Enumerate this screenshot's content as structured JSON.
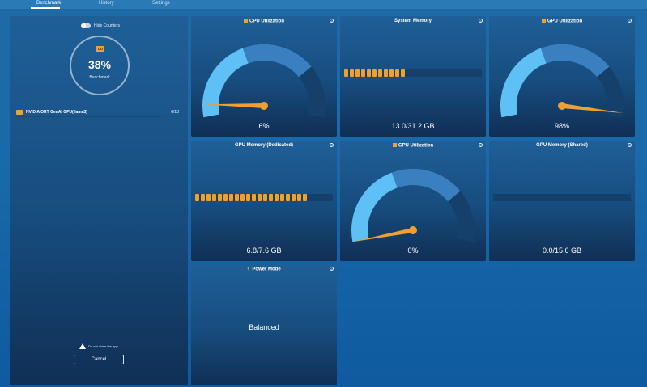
{
  "tabs": [
    {
      "label": "Benchmark",
      "active": true
    },
    {
      "label": "History",
      "active": false
    },
    {
      "label": "Settings",
      "active": false
    }
  ],
  "colors": {
    "accent": "#f0a030",
    "gauge_light": "#5fc0f5",
    "gauge_mid": "#3a7fc0",
    "gauge_track": "#14406b"
  },
  "left_panel": {
    "toggle_label": "Hide Counters",
    "badge": "OD",
    "score": "38%",
    "score_label": "Benchmark",
    "model_name": "NVIDIA ORT GenAI GPU(llama3)",
    "model_count": "0/10",
    "warning_text": "Do not close the app",
    "cancel_label": "Cancel"
  },
  "cards": {
    "cpu": {
      "title": "CPU Utilization",
      "value": "6%",
      "level": 0.06
    },
    "sys_mem": {
      "title": "System Memory",
      "value": "13.0/31.2 GB",
      "blocks": 11
    },
    "gpu_util_1": {
      "title": "GPU Utilization",
      "value": "98%",
      "level": 0.98
    },
    "gpu_mem_dedicated": {
      "title": "GPU Memory (Dedicated)",
      "value": "6.8/7.6 GB",
      "blocks": 20
    },
    "gpu_util_2": {
      "title": "GPU Utilization",
      "value": "0%",
      "level": 0.0
    },
    "gpu_mem_shared": {
      "title": "GPU Memory (Shared)",
      "value": "0.0/15.6 GB",
      "blocks": 0
    },
    "power": {
      "title": "Power Mode",
      "value": "Balanced"
    }
  }
}
